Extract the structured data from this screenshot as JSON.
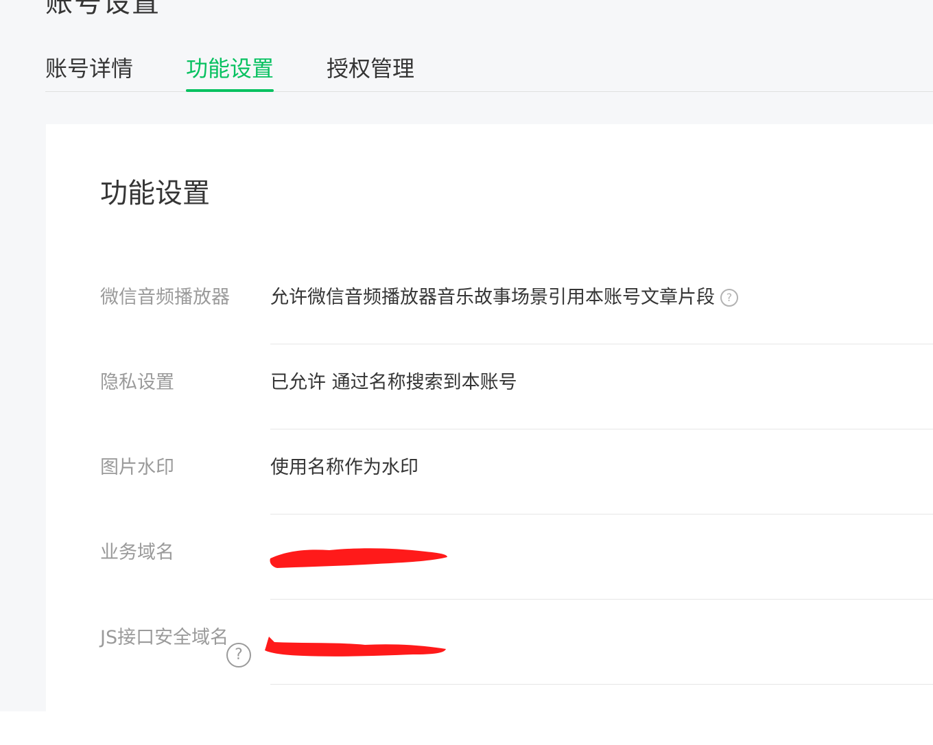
{
  "page": {
    "title": "账号设置"
  },
  "tabs": [
    {
      "label": "账号详情"
    },
    {
      "label": "功能设置"
    },
    {
      "label": "授权管理"
    }
  ],
  "section": {
    "title": "功能设置"
  },
  "settings": [
    {
      "label": "微信音频播放器",
      "value": "允许微信音频播放器音乐故事场景引用本账号文章片段"
    },
    {
      "label": "隐私设置",
      "value": "已允许 通过名称搜索到本账号"
    },
    {
      "label": "图片水印",
      "value": "使用名称作为水印"
    },
    {
      "label": "业务域名",
      "value": ""
    },
    {
      "label": "JS接口安全域名",
      "value": ""
    }
  ],
  "colors": {
    "accent": "#07c160",
    "redaction": "#ff1a1a"
  }
}
